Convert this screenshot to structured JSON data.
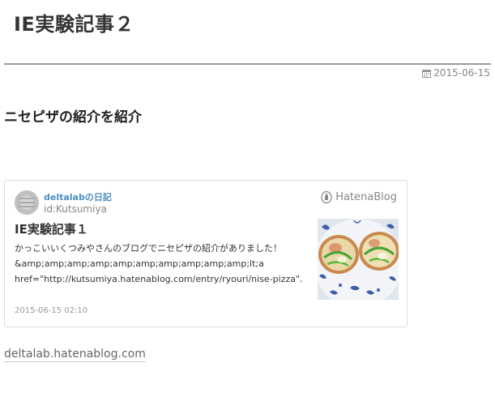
{
  "blog": {
    "title": "IE実験記事２"
  },
  "entry": {
    "date": "2015-06-15",
    "date_icon": "calendar-icon",
    "title": "ニセピザの紹介を紹介"
  },
  "embed": {
    "blog_name": "deltalabの日記",
    "author_id": "id:Kutsumiya",
    "service_label": "HatenaBlog",
    "title": "IE実験記事１",
    "excerpt_lines": [
      "かっこいいくつみやさんのブログでニセピザの紹介がありました！",
      "&amp;amp;amp;amp;amp;amp;amp;amp;amp;amp;lt;a",
      "href=\"http://kutsumiya.hatenablog.com/entry/ryouri/nise-pizza\"…"
    ],
    "date": "2015-06-15 02:10"
  },
  "footer": {
    "url": "deltalab.hatenablog.com"
  }
}
